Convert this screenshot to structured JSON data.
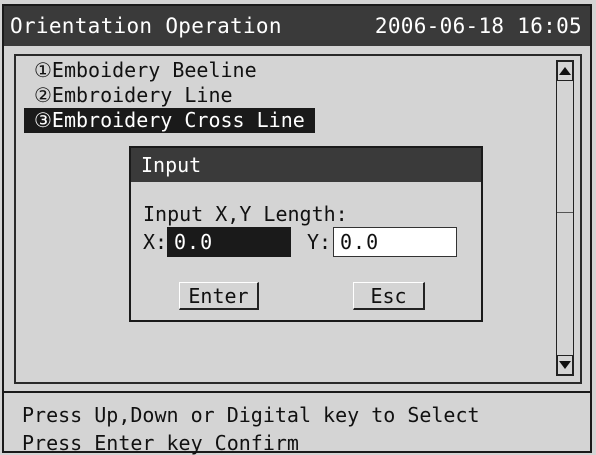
{
  "title": "Orientation Operation",
  "datetime": "2006-06-18 16:05",
  "list": {
    "items": [
      {
        "label": "①Emboidery Beeline",
        "selected": false
      },
      {
        "label": "②Embroidery Line",
        "selected": false
      },
      {
        "label": "③Embroidery Cross Line",
        "selected": true
      }
    ]
  },
  "dialog": {
    "title": "Input",
    "prompt": "Input X,Y Length:",
    "x_label": "X:",
    "x_value": "0.0",
    "y_label": "Y:",
    "y_value": "0.0",
    "enter_label": "Enter",
    "esc_label": "Esc"
  },
  "status": {
    "line1": "Press Up,Down or Digital key to  Select",
    "line2": "Press Enter key Confirm"
  },
  "colors": {
    "titlebar": "#3a3a3a",
    "selection": "#1a1a1a",
    "background": "#d4d4d4"
  }
}
